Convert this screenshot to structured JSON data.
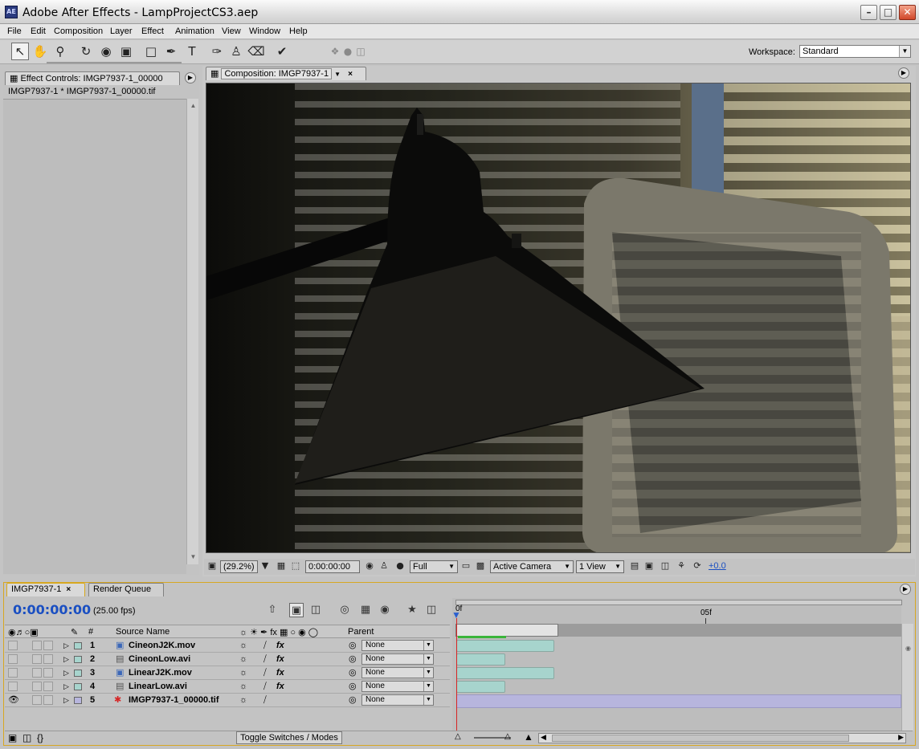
{
  "window": {
    "app_icon": "AE",
    "title": "Adobe After Effects - LampProjectCS3.aep"
  },
  "menu": [
    "File",
    "Edit",
    "Composition",
    "Layer",
    "Effect",
    "Animation",
    "View",
    "Window",
    "Help"
  ],
  "workspace": {
    "label": "Workspace:",
    "value": "Standard"
  },
  "effect_controls": {
    "tab_label": "Effect Controls: IMGP7937-1_00000",
    "subheader": "IMGP7937-1 * IMGP7937-1_00000.tif"
  },
  "composition": {
    "tab_label": "Composition: IMGP7937-1",
    "zoom": "(29.2%)",
    "timecode": "0:00:00:00",
    "resolution": "Full",
    "camera": "Active Camera",
    "views": "1 View",
    "exposure": "+0.0"
  },
  "timeline": {
    "tabs": [
      "IMGP7937-1",
      "Render Queue"
    ],
    "timecode": "0:00:00:00",
    "fps": "(25.00 fps)",
    "ruler_labels": [
      "0f",
      "05f"
    ],
    "columns": {
      "number": "#",
      "source_name": "Source Name",
      "parent": "Parent"
    },
    "layers": [
      {
        "num": "1",
        "name": "CineonJ2K.mov",
        "parent": "None",
        "label_color": "#a7d4cd",
        "visible": false,
        "fx": true
      },
      {
        "num": "2",
        "name": "CineonLow.avi",
        "parent": "None",
        "label_color": "#a7d4cd",
        "visible": false,
        "fx": true
      },
      {
        "num": "3",
        "name": "LinearJ2K.mov",
        "parent": "None",
        "label_color": "#a7d4cd",
        "visible": false,
        "fx": true
      },
      {
        "num": "4",
        "name": "LinearLow.avi",
        "parent": "None",
        "label_color": "#a7d4cd",
        "visible": false,
        "fx": true
      },
      {
        "num": "5",
        "name": "IMGP7937-1_00000.tif",
        "parent": "None",
        "label_color": "#b7b5dd",
        "visible": true,
        "fx": false
      }
    ],
    "toggle_button": "Toggle Switches / Modes"
  },
  "colors": {
    "timecode_blue": "#1a4fc2",
    "timeline_border": "#d7a722",
    "cti_red": "#d62525"
  }
}
